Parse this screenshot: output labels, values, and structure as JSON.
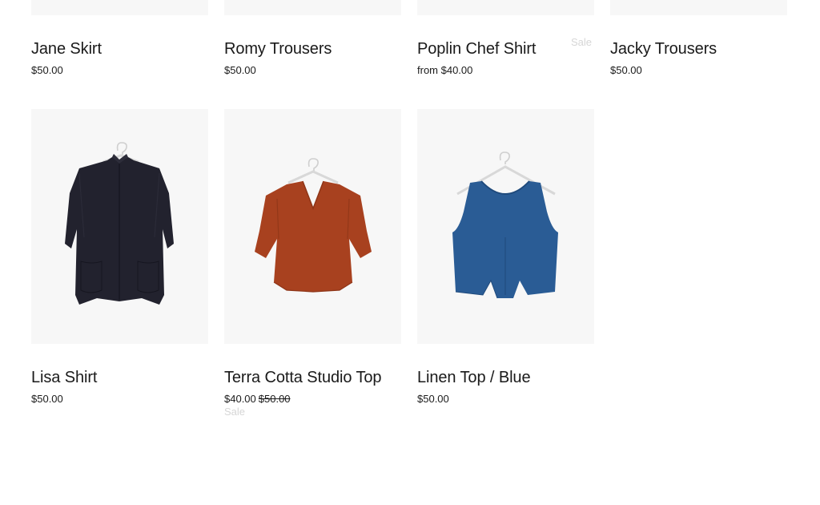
{
  "products_row1": [
    {
      "name": "Jane Skirt",
      "price": "$50.00"
    },
    {
      "name": "Romy Trousers",
      "price": "$50.00"
    },
    {
      "name": "Poplin Chef Shirt",
      "price": "from $40.00",
      "badge": "Sale"
    },
    {
      "name": "Jacky Trousers",
      "price": "$50.00"
    }
  ],
  "products_row2": [
    {
      "name": "Lisa Shirt",
      "price": "$50.00",
      "image": "navy-short-sleeve-shirt"
    },
    {
      "name": "Terra Cotta Studio Top",
      "price": "$40.00",
      "compare_price": "$50.00",
      "badge": "Sale",
      "image": "terracotta-v-neck-top"
    },
    {
      "name": "Linen Top / Blue",
      "price": "$50.00",
      "image": "blue-sleeveless-top"
    }
  ],
  "colors": {
    "image_bg": "#f7f7f7",
    "sale_badge": "#d6d6d6",
    "navy": "#22222e",
    "terracotta": "#a8411f",
    "blue": "#2a5c95"
  }
}
